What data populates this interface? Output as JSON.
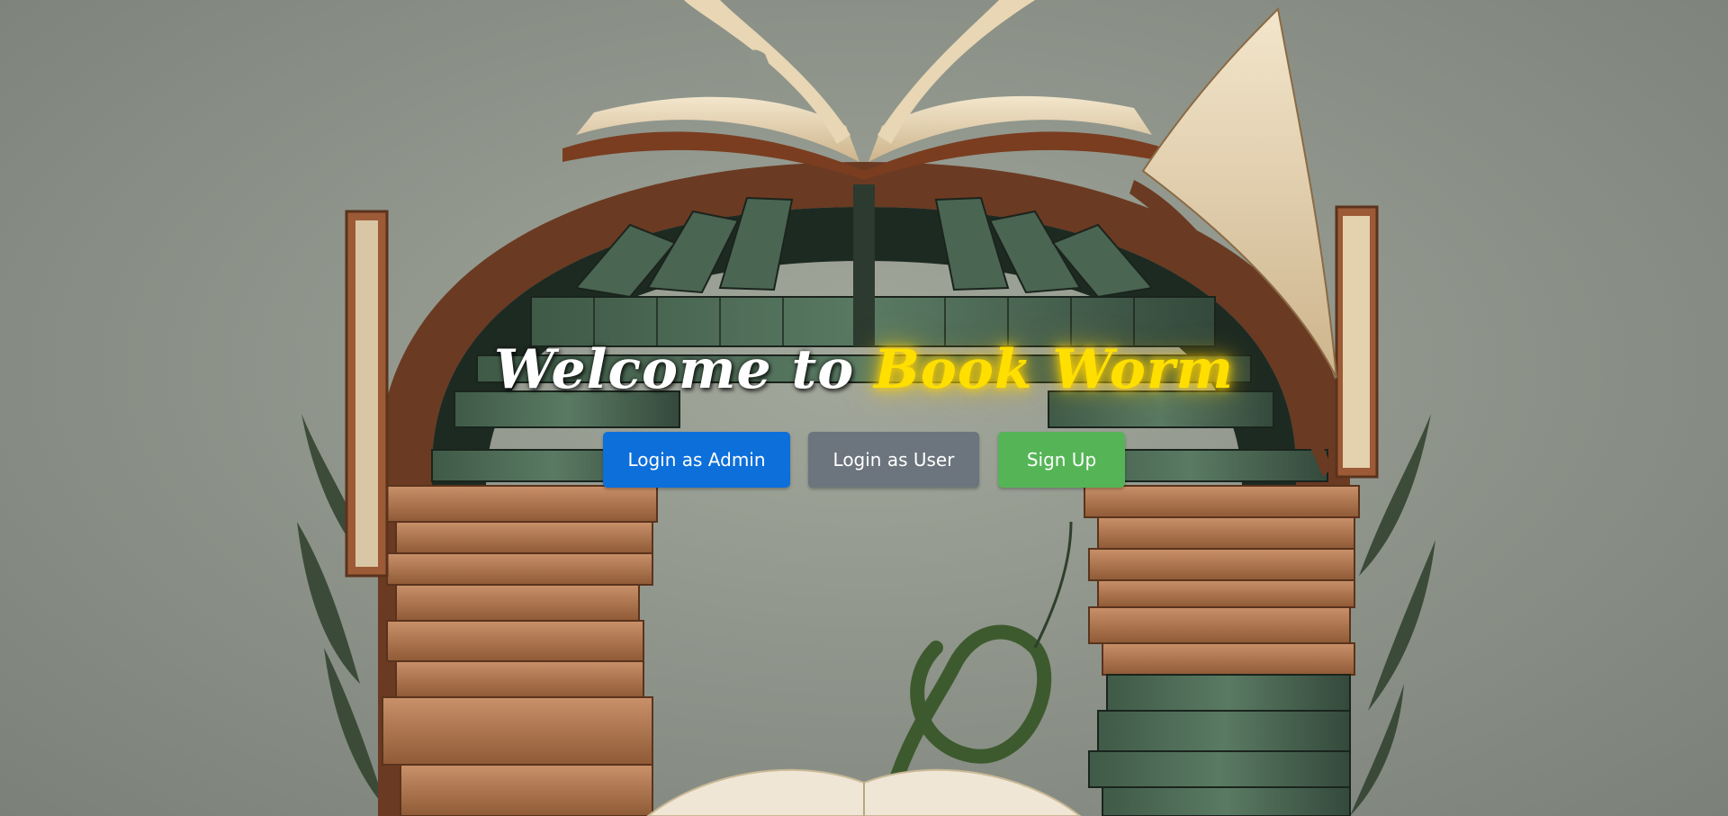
{
  "hero": {
    "welcome_text": "Welcome to",
    "brand_name": "Book Worm"
  },
  "actions": {
    "login_admin_label": "Login as Admin",
    "login_user_label": "Login as User",
    "signup_label": "Sign Up"
  },
  "colors": {
    "background": "#8f958b",
    "brand_glow": "#ffdf00",
    "admin_button": "#0d6fda",
    "user_button": "#6c757d",
    "signup_button": "#55b556"
  },
  "icons": [
    "book-arch-illustration"
  ]
}
